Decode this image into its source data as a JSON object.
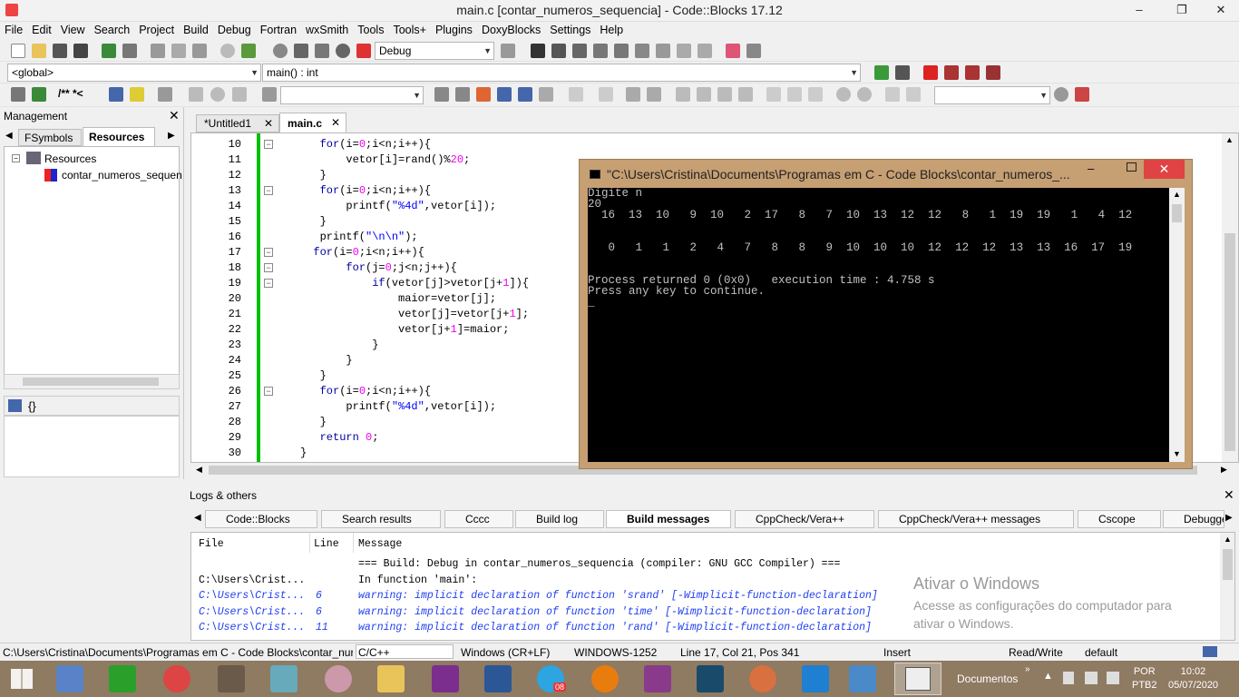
{
  "window": {
    "title": "main.c [contar_numeros_sequencia] - Code::Blocks 17.12",
    "min": "–",
    "max": "❐",
    "close": "✕"
  },
  "menu": [
    "File",
    "Edit",
    "View",
    "Search",
    "Project",
    "Build",
    "Debug",
    "Fortran",
    "wxSmith",
    "Tools",
    "Tools+",
    "Plugins",
    "DoxyBlocks",
    "Settings",
    "Help"
  ],
  "toolbar": {
    "build_target": "Debug",
    "scope": "<global>",
    "function": "main() : int",
    "doc_comment": "/** *<"
  },
  "management": {
    "title": "Management",
    "tabs": [
      "FSymbols",
      "Resources"
    ],
    "tree_root": "Resources",
    "tree_child": "contar_numeros_sequen",
    "bottom_label": "{}"
  },
  "editor": {
    "tabs": [
      "*Untitled1",
      "main.c"
    ],
    "lines": [
      {
        "n": "10",
        "html": "   <span class=kw>for</span>(i=<span class=num>0</span>;i&lt;n;i++){"
      },
      {
        "n": "11",
        "html": "       vetor[i]=rand()%<span class=num>20</span>;"
      },
      {
        "n": "12",
        "html": "   }"
      },
      {
        "n": "13",
        "html": "   <span class=kw>for</span>(i=<span class=num>0</span>;i&lt;n;i++){"
      },
      {
        "n": "14",
        "html": "       printf(<span class=str>\"%4d\"</span>,vetor[i]);"
      },
      {
        "n": "15",
        "html": "   }"
      },
      {
        "n": "16",
        "html": "   printf(<span class=str>\"\\n\\n\"</span>);"
      },
      {
        "n": "17",
        "html": "  <span class=kw>for</span>(i=<span class=num>0</span>;i&lt;n;i++){"
      },
      {
        "n": "18",
        "html": "       <span class=kw>for</span>(j=<span class=num>0</span>;j&lt;n;j++){"
      },
      {
        "n": "19",
        "html": "           <span class=kw>if</span>(vetor[j]&gt;vetor[j+<span class=num>1</span>]){"
      },
      {
        "n": "20",
        "html": "               maior=vetor[j];"
      },
      {
        "n": "21",
        "html": "               vetor[j]=vetor[j+<span class=num>1</span>];"
      },
      {
        "n": "22",
        "html": "               vetor[j+<span class=num>1</span>]=maior;"
      },
      {
        "n": "23",
        "html": "           }"
      },
      {
        "n": "24",
        "html": "       }"
      },
      {
        "n": "25",
        "html": "   }"
      },
      {
        "n": "26",
        "html": "   <span class=kw>for</span>(i=<span class=num>0</span>;i&lt;n;i++){"
      },
      {
        "n": "27",
        "html": "       printf(<span class=str>\"%4d\"</span>,vetor[i]);"
      },
      {
        "n": "28",
        "html": "   }"
      },
      {
        "n": "29",
        "html": "   <span class=kw>return</span> <span class=num>0</span>;"
      },
      {
        "n": "30",
        "html": "}"
      }
    ]
  },
  "console": {
    "title": "\"C:\\Users\\Cristina\\Documents\\Programas em C - Code Blocks\\contar_numeros_...",
    "text": "Digite n\n20\n  16  13  10   9  10   2  17   8   7  10  13  12  12   8   1  19  19   1   4  12\n\n\n   0   1   1   2   4   7   8   8   9  10  10  10  12  12  12  13  13  16  17  19\n\n\nProcess returned 0 (0x0)   execution time : 4.758 s\nPress any key to continue.\n_"
  },
  "logs": {
    "title": "Logs & others",
    "tabs": [
      "Code::Blocks",
      "Search results",
      "Cccc",
      "Build log",
      "Build messages",
      "CppCheck/Vera++",
      "CppCheck/Vera++ messages",
      "Cscope",
      "Debugge"
    ],
    "headers": [
      "File",
      "Line",
      "Message"
    ],
    "rows": [
      {
        "file": "",
        "line": "",
        "msg": "=== Build: Debug in contar_numeros_sequencia (compiler: GNU GCC Compiler) ===",
        "warn": false
      },
      {
        "file": "C:\\Users\\Crist...",
        "line": "",
        "msg": "In function 'main':",
        "warn": false
      },
      {
        "file": "C:\\Users\\Crist...",
        "line": "6",
        "msg": "warning: implicit declaration of function 'srand' [-Wimplicit-function-declaration]",
        "warn": true
      },
      {
        "file": "C:\\Users\\Crist...",
        "line": "6",
        "msg": "warning: implicit declaration of function 'time' [-Wimplicit-function-declaration]",
        "warn": true
      },
      {
        "file": "C:\\Users\\Crist...",
        "line": "11",
        "msg": "warning: implicit declaration of function 'rand' [-Wimplicit-function-declaration]",
        "warn": true
      }
    ],
    "watermark_title": "Ativar o Windows",
    "watermark_text": "Acesse as configurações do computador para ativar o Windows."
  },
  "status": {
    "path": "C:\\Users\\Cristina\\Documents\\Programas em C - Code Blocks\\contar_nur",
    "lang": "C/C++",
    "eol": "Windows (CR+LF)",
    "enc": "WINDOWS-1252",
    "pos": "Line 17, Col 21, Pos 341",
    "mode": "Insert",
    "rw": "Read/Write",
    "theme": "default"
  },
  "taskbar": {
    "folder": "Documentos",
    "lang1": "POR",
    "lang2": "PTB2",
    "time": "10:02",
    "date": "05/07/2020",
    "badge": "08"
  },
  "colors": {
    "console_frame": "#c69f73",
    "accent_green": "#00c000",
    "taskbar": "#8f7a62"
  }
}
